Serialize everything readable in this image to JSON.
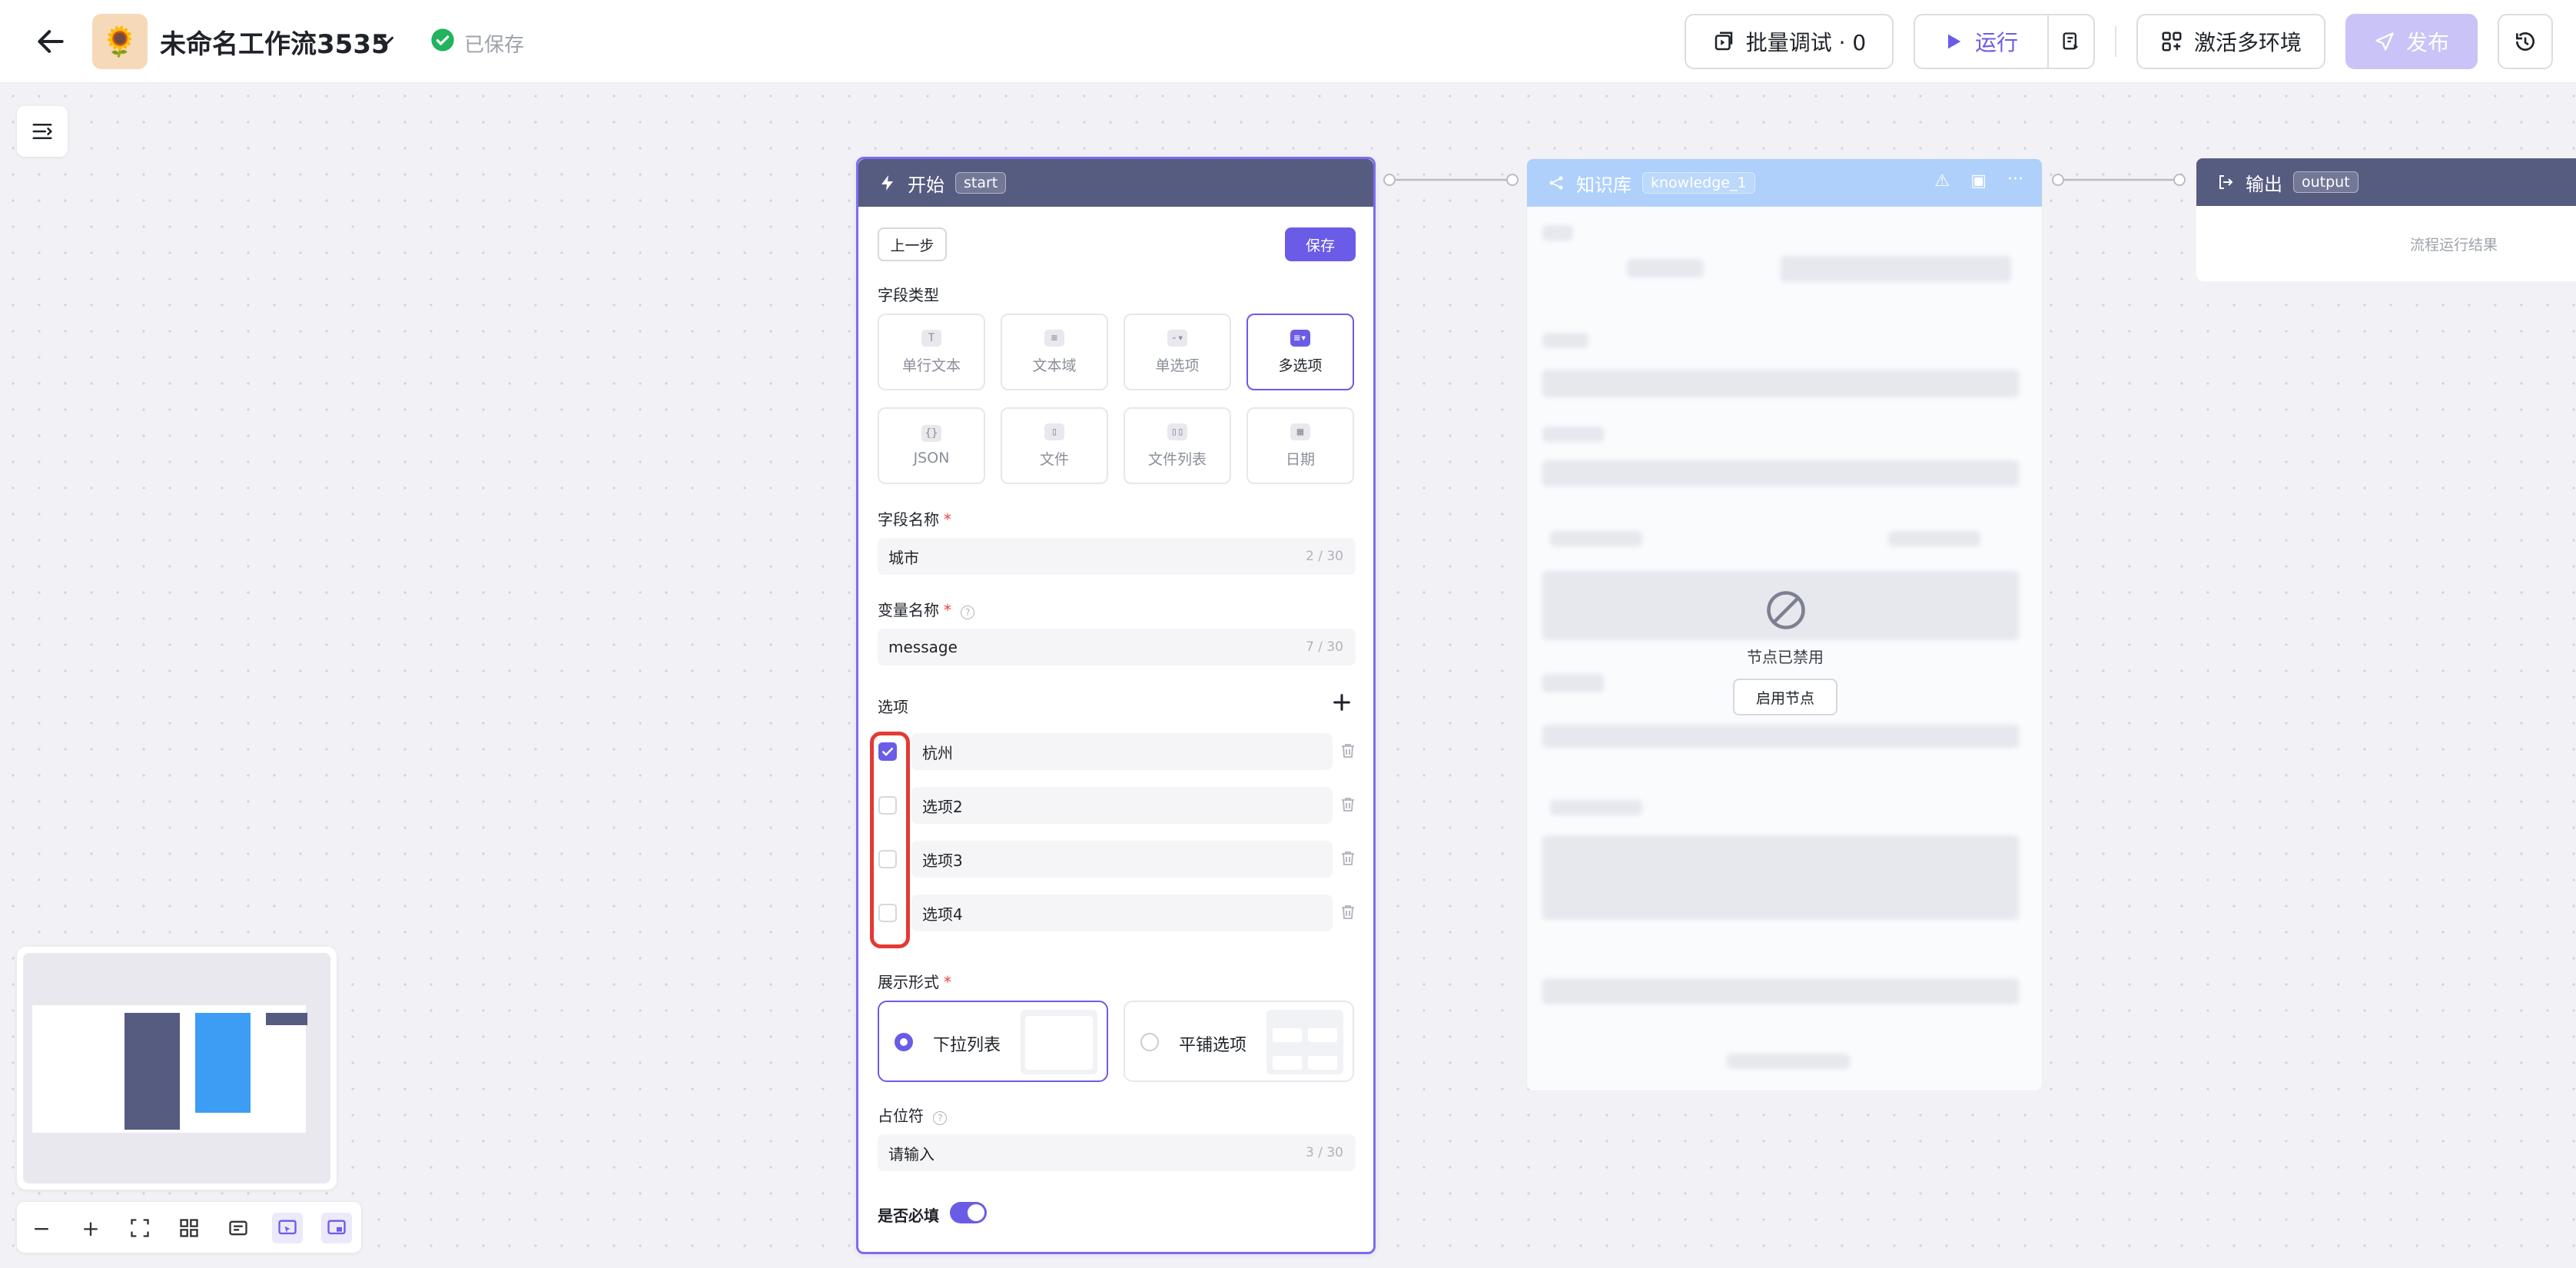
{
  "header": {
    "title": "未命名工作流3535",
    "saved_status": "已保存",
    "batch_debug": "批量调试 · 0",
    "run": "运行",
    "activate_env": "激活多环境",
    "publish": "发布"
  },
  "start_node": {
    "title": "开始",
    "tag": "start",
    "prev_step": "上一步",
    "save": "保存",
    "field_type_label": "字段类型",
    "field_types": [
      "单行文本",
      "文本域",
      "单选项",
      "多选项",
      "JSON",
      "文件",
      "文件列表",
      "日期"
    ],
    "selected_field_type": "多选项",
    "field_name_label": "字段名称",
    "field_name_value": "城市",
    "field_name_count": "2 / 30",
    "var_name_label": "变量名称",
    "var_name_value": "message",
    "var_name_count": "7 / 30",
    "options_label": "选项",
    "options": [
      {
        "label": "杭州",
        "checked": true
      },
      {
        "label": "选项2",
        "checked": false
      },
      {
        "label": "选项3",
        "checked": false
      },
      {
        "label": "选项4",
        "checked": false
      }
    ],
    "display_label": "展示形式",
    "display_options": [
      "下拉列表",
      "平铺选项"
    ],
    "display_selected": "下拉列表",
    "placeholder_label": "占位符",
    "placeholder_value": "请输入",
    "placeholder_count": "3 / 30",
    "required_label": "是否必填",
    "required_on": true
  },
  "knowledge_node": {
    "title": "知识库",
    "tag": "knowledge_1",
    "disabled_text": "节点已禁用",
    "enable_button": "启用节点"
  },
  "output_node": {
    "title": "输出",
    "tag": "output",
    "placeholder": "流程运行结果"
  },
  "colors": {
    "accent": "#6b5ce7",
    "node_header": "#565b80",
    "knowledge_header": "#aed0fb",
    "highlight": "#e53935"
  }
}
